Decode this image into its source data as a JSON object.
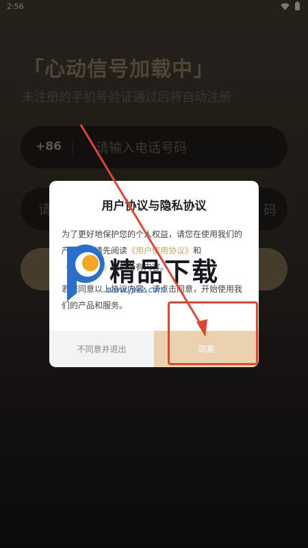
{
  "status_bar": {
    "time": "2:56"
  },
  "header": {
    "title": "「心动信号加载中」",
    "subtitle": "未注册的手机号验证通过后将自动注册"
  },
  "phone_field": {
    "country_code": "+86",
    "placeholder": "请输入电话号码"
  },
  "code_field": {
    "placeholder": "请",
    "get_code_label": "码"
  },
  "dialog": {
    "title": "用户协议与隐私协议",
    "para1_a": "为了更好地保护您的个人权益，请您在使用我们的产品前，请先阅读",
    "user_agreement_link": "《用户使用协议》",
    "para1_b": "和",
    "privacy_link": "《隐私条例》",
    "para1_c": "内的所有内容。",
    "para2": "若您同意以上协议内容，请点击同意，开始使用我们的产品和服务。",
    "disagree_label": "不同意并退出",
    "agree_label": "同意"
  },
  "watermark": {
    "text": "精品下载",
    "url": "www.jpxz.com"
  },
  "colors": {
    "accent": "#c8a46a",
    "agree_bg": "#ead2b0",
    "highlight": "#e0452f"
  }
}
